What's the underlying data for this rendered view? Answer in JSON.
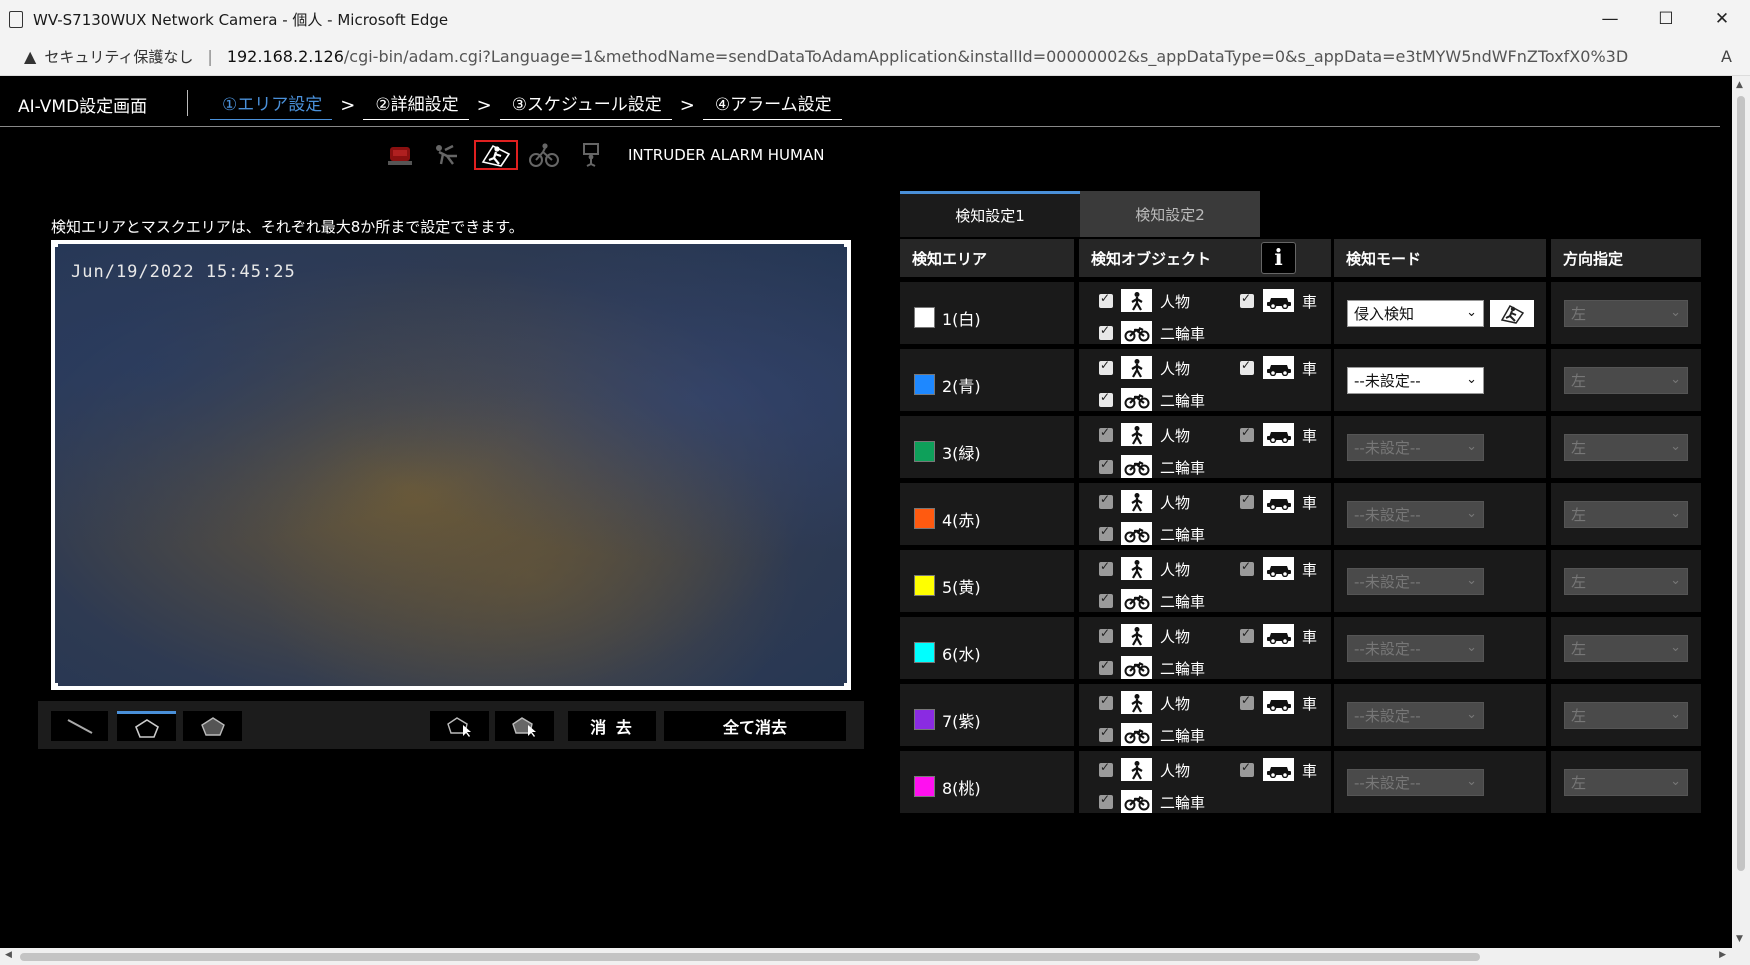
{
  "window": {
    "title": "WV-S7130WUX Network Camera - 個人 - Microsoft Edge",
    "minimize": "—",
    "maximize": "☐",
    "close": "✕"
  },
  "addressbar": {
    "security_label": "セキュリティ保護なし",
    "url_host": "192.168.2.126",
    "url_path": "/cgi-bin/adam.cgi?Language=1&methodName=sendDataToAdamApplication&installId=00000002&s_appDataType=0&s_appData=e3tMYW5ndWFnZToxfX0%3D",
    "read_aloud": "A"
  },
  "header": {
    "app_title": "AI-VMD設定画面",
    "steps": [
      "①エリア設定",
      "②詳細設定",
      "③スケジュール設定",
      "④アラーム設定"
    ],
    "active_step": 0,
    "arrow": ">"
  },
  "mode": {
    "icons": [
      "alarm-light-icon",
      "fallen-person-icon",
      "intruder-human-icon",
      "cyclist-icon",
      "loitering-icon"
    ],
    "selected": 2,
    "label": "INTRUDER ALARM HUMAN"
  },
  "camera": {
    "note": "検知エリアとマスクエリアは、それぞれ最大8か所まで設定できます。",
    "timestamp": "Jun/19/2022 15:45:25"
  },
  "toolbar": {
    "tools": [
      "line-tool",
      "polygon-outline-tool",
      "polygon-filled-tool",
      "select-area-tool",
      "select-mask-tool"
    ],
    "active_tool": 1,
    "delete_label": "消 去",
    "delete_all_label": "全て消去"
  },
  "panel": {
    "tabs": [
      "検知設定1",
      "検知設定2"
    ],
    "active_tab": 0,
    "headers": {
      "area": "検知エリア",
      "object": "検知オブジェクト",
      "mode": "検知モード",
      "direction": "方向指定"
    },
    "object_labels": {
      "person": "人物",
      "car": "車",
      "bike": "二輪車"
    },
    "rows": [
      {
        "label": "1(白)",
        "color": "#ffffff",
        "mode": "侵入検知",
        "direction": "左",
        "enabled": true,
        "configured": true
      },
      {
        "label": "2(青)",
        "color": "#1e88ff",
        "mode": "--未設定--",
        "direction": "左",
        "enabled": true,
        "configured": false
      },
      {
        "label": "3(緑)",
        "color": "#0ea05a",
        "mode": "--未設定--",
        "direction": "左",
        "enabled": false,
        "configured": false
      },
      {
        "label": "4(赤)",
        "color": "#ff5a10",
        "mode": "--未設定--",
        "direction": "左",
        "enabled": false,
        "configured": false
      },
      {
        "label": "5(黄)",
        "color": "#ffff00",
        "mode": "--未設定--",
        "direction": "左",
        "enabled": false,
        "configured": false
      },
      {
        "label": "6(水)",
        "color": "#00ffff",
        "mode": "--未設定--",
        "direction": "左",
        "enabled": false,
        "configured": false
      },
      {
        "label": "7(紫)",
        "color": "#8a2be2",
        "mode": "--未設定--",
        "direction": "左",
        "enabled": false,
        "configured": false
      },
      {
        "label": "8(桃)",
        "color": "#ff10f0",
        "mode": "--未設定--",
        "direction": "左",
        "enabled": false,
        "configured": false
      }
    ]
  },
  "colors": {
    "accent": "#4a90d9",
    "selection_border": "#e02020"
  }
}
